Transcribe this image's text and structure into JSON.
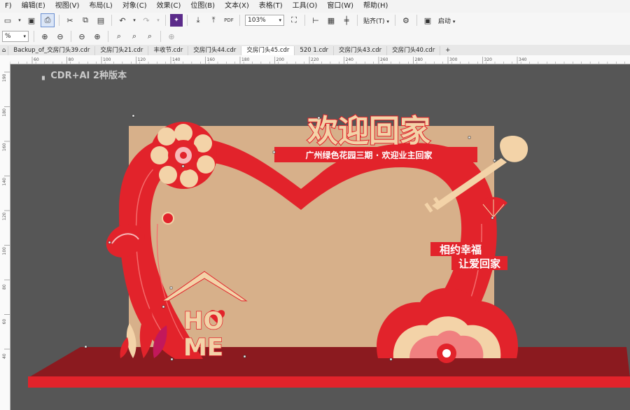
{
  "menu": [
    "F)",
    "编辑(E)",
    "视图(V)",
    "布局(L)",
    "对象(C)",
    "效果(C)",
    "位图(B)",
    "文本(X)",
    "表格(T)",
    "工具(O)",
    "窗口(W)",
    "帮助(H)"
  ],
  "toolbar": {
    "zoom_value": "103%",
    "snap_label": "贴齐(T)",
    "launch_label": "启动"
  },
  "toolbar2": {
    "size_value": "%"
  },
  "tabs": [
    {
      "label": "Backup_of_交房门头39.cdr",
      "active": false
    },
    {
      "label": "交房门头21.cdr",
      "active": false
    },
    {
      "label": "丰收节.cdr",
      "active": false
    },
    {
      "label": "交房门头44.cdr",
      "active": false
    },
    {
      "label": "交房门头45.cdr",
      "active": true
    },
    {
      "label": "520 1.cdr",
      "active": false
    },
    {
      "label": "交房门头43.cdr",
      "active": false
    },
    {
      "label": "交房门头40.cdr",
      "active": false
    }
  ],
  "ruler_top": [
    {
      "label": "60"
    },
    {
      "label": "80"
    },
    {
      "label": "100"
    },
    {
      "label": "120"
    },
    {
      "label": "140"
    },
    {
      "label": "160"
    },
    {
      "label": "180"
    },
    {
      "label": "200"
    },
    {
      "label": "220"
    },
    {
      "label": "240"
    },
    {
      "label": "260"
    },
    {
      "label": "280"
    },
    {
      "label": "300"
    },
    {
      "label": "320"
    },
    {
      "label": "340"
    }
  ],
  "ruler_left": [
    {
      "label": "190"
    },
    {
      "label": "180"
    },
    {
      "label": "160"
    },
    {
      "label": "140"
    },
    {
      "label": "120"
    },
    {
      "label": "100"
    },
    {
      "label": "80"
    },
    {
      "label": "60"
    },
    {
      "label": "40"
    }
  ],
  "canvas": {
    "watermark": "CDR+AI 2种版本",
    "title": "欢迎回家",
    "subtitle": "广州绿色花园三期 · 欢迎业主回家",
    "slogan_line1": "相约幸福",
    "slogan_line2": "让爱回家",
    "home_top": "HO",
    "home_bottom": "ME"
  },
  "colors": {
    "red": "#e2232b",
    "dark_red": "#8b1a1f",
    "beige": "#d7b08a",
    "canvas_bg": "#565656"
  }
}
